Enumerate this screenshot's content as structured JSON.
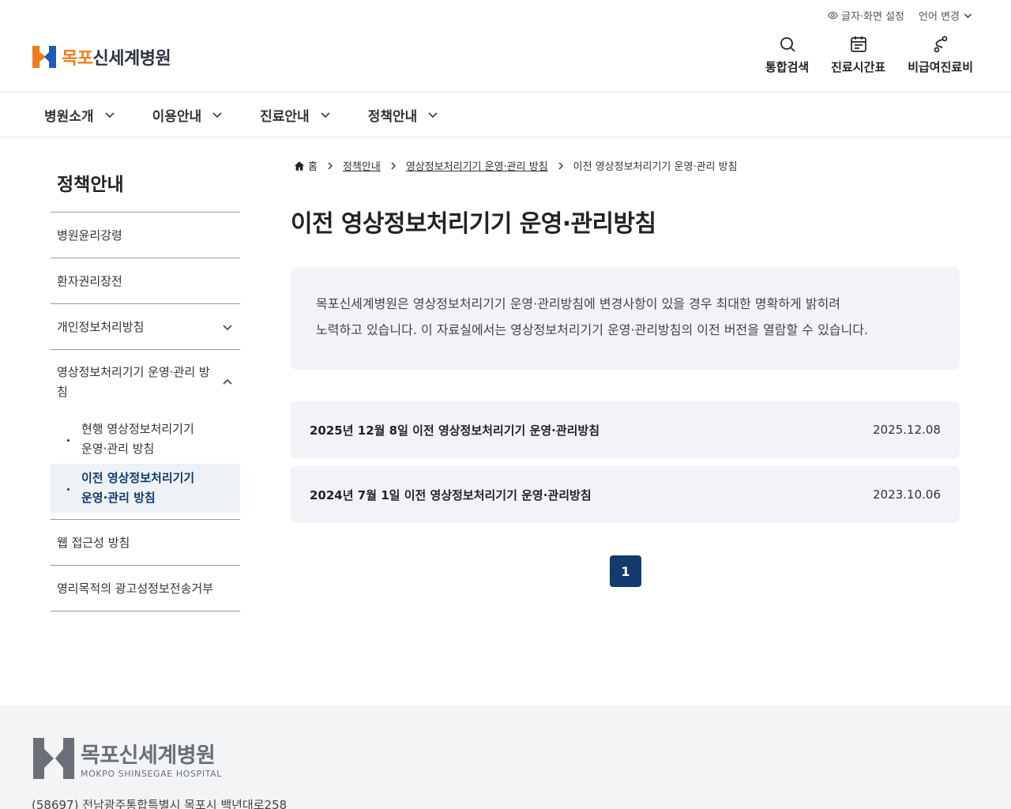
{
  "header": {
    "util": {
      "font_setting": "글자·화면 설정",
      "language": "언어 변경"
    },
    "logo": {
      "brand_part1": "목포",
      "brand_part2": "신세계병원"
    },
    "quick": [
      {
        "label": "통합검색",
        "icon": "search-icon"
      },
      {
        "label": "진료시간표",
        "icon": "calendar-icon"
      },
      {
        "label": "비급여진료비",
        "icon": "route-icon"
      }
    ]
  },
  "gnb": {
    "items": [
      "병원소개",
      "이용안내",
      "진료안내",
      "정책안내"
    ]
  },
  "sidebar": {
    "title": "정책안내",
    "items": [
      "병원윤리강령",
      "환자권리장전",
      "개인정보처리방침",
      "영상정보처리기기 운영·관리 방침",
      "웹 접근성 방침",
      "영리목적의 광고성정보전송거부"
    ],
    "sub_items": [
      "현행 영상정보처리기기 운영·관리 방침",
      "이전 영상정보처리기기 운영·관리 방침"
    ]
  },
  "breadcrumb": {
    "home": "홈",
    "level1": "정책안내",
    "level2": "영상정보처리기기 운영·관리 방침",
    "current": "이전 영상정보처리기기 운영·관리 방침"
  },
  "main": {
    "title": "이전 영상정보처리기기 운영·관리방침",
    "notice_line1": "목포신세계병원은 영상정보처리기기 운영·관리방침에 변경사항이 있을 경우 최대한 명확하게 밝히려",
    "notice_line2": "노력하고 있습니다. 이 자료실에서는 영상정보처리기기 운영·관리방침의 이전 버전을 열람할 수 있습니다.",
    "documents": [
      {
        "title": "2025년 12월 8일 이전 영상정보처리기기 운영·관리방침",
        "date": "2025.12.08"
      },
      {
        "title": "2024년 7월 1일 이전 영상정보처리기기 운영·관리방침",
        "date": "2023.10.06"
      }
    ],
    "page": "1"
  },
  "footer": {
    "name_kr": "목포신세계병원",
    "name_en": "MOKPO SHINSEGAE HOSPITAL",
    "address": "(58697) 전남광주통합특별시 목포시 백년대로258"
  },
  "colors": {
    "brand_orange": "#ef7d1a",
    "brand_blue": "#1d5bbf",
    "navy": "#123b6b",
    "panel_bg": "#f1f3f6"
  }
}
